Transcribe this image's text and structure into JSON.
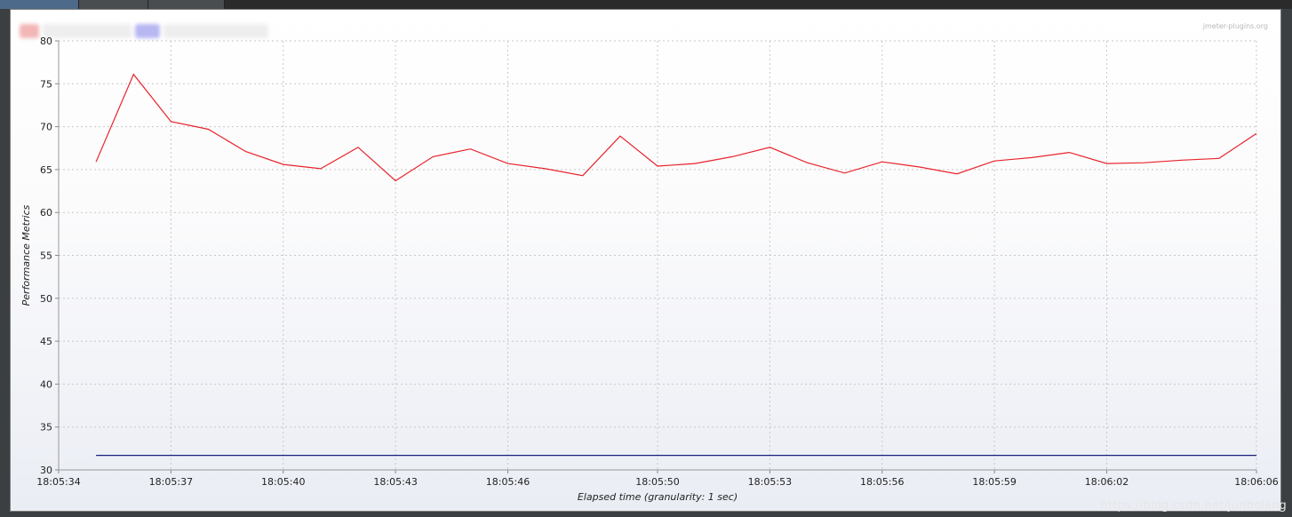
{
  "brand": "jmeter-plugins.org",
  "watermark": "https://blog.csdn.net/junbolang",
  "colors": {
    "series_red": "#e8232b",
    "series_navy": "#1a1f7a",
    "grid": "#c8c8c8"
  },
  "chart_data": {
    "type": "line",
    "xlabel": "Elapsed time (granularity: 1 sec)",
    "ylabel": "Performance Metrics",
    "ylim": [
      30,
      80
    ],
    "yticks": [
      30,
      35,
      40,
      45,
      50,
      55,
      60,
      65,
      70,
      75,
      80
    ],
    "xlim": [
      "18:05:34",
      "18:06:06"
    ],
    "xticks": [
      "18:05:34",
      "18:05:37",
      "18:05:40",
      "18:05:43",
      "18:05:46",
      "18:05:50",
      "18:05:53",
      "18:05:56",
      "18:05:59",
      "18:06:02",
      "18:06:06"
    ],
    "grid": true,
    "series": [
      {
        "color": "#e8232b",
        "x": [
          "18:05:35",
          "18:05:36",
          "18:05:37",
          "18:05:38",
          "18:05:39",
          "18:05:40",
          "18:05:41",
          "18:05:42",
          "18:05:43",
          "18:05:44",
          "18:05:45",
          "18:05:46",
          "18:05:47",
          "18:05:48",
          "18:05:49",
          "18:05:50",
          "18:05:51",
          "18:05:52",
          "18:05:53",
          "18:05:54",
          "18:05:55",
          "18:05:56",
          "18:05:57",
          "18:05:58",
          "18:05:59",
          "18:06:00",
          "18:06:01",
          "18:06:02",
          "18:06:03",
          "18:06:04",
          "18:06:05",
          "18:06:06"
        ],
        "values": [
          65.9,
          76.1,
          70.6,
          69.7,
          67.1,
          65.6,
          65.1,
          67.6,
          63.7,
          66.5,
          67.4,
          65.7,
          65.1,
          64.3,
          68.9,
          65.4,
          65.7,
          66.5,
          67.6,
          65.8,
          64.6,
          65.9,
          65.3,
          64.5,
          66.0,
          66.4,
          67.0,
          65.7,
          65.8,
          66.1,
          66.3,
          69.2
        ]
      },
      {
        "color": "#1a1f7a",
        "x": [
          "18:05:35",
          "18:06:06"
        ],
        "values": [
          31.7,
          31.7
        ]
      }
    ]
  }
}
